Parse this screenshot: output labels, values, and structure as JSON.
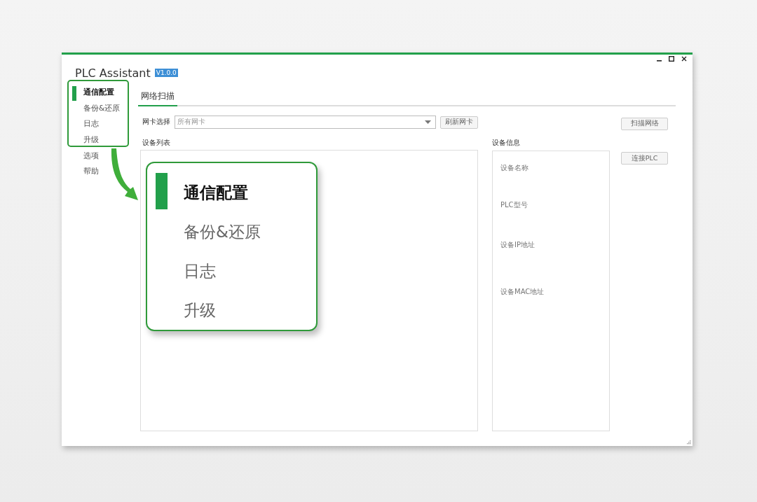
{
  "window": {
    "title": "PLC Assistant",
    "version": "V1.0.0"
  },
  "sidebar": {
    "items": [
      {
        "label": "通信配置",
        "selected": true
      },
      {
        "label": "备份&还原",
        "selected": false
      },
      {
        "label": "日志",
        "selected": false
      },
      {
        "label": "升级",
        "selected": false
      },
      {
        "label": "选项",
        "selected": false
      },
      {
        "label": "帮助",
        "selected": false
      }
    ]
  },
  "tabs": [
    {
      "label": "网络扫描",
      "selected": true
    }
  ],
  "nic": {
    "label": "网卡选择",
    "placeholder": "所有网卡",
    "refresh_button": "刷新网卡"
  },
  "scan_button": "扫描网络",
  "connect_button": "连接PLC",
  "device_list": {
    "title": "设备列表"
  },
  "device_info": {
    "title": "设备信息",
    "fields": [
      "设备名称",
      "PLC型号",
      "设备IP地址",
      "设备MAC地址"
    ]
  },
  "callout": {
    "items": [
      {
        "label": "通信配置",
        "selected": true
      },
      {
        "label": "备份&还原",
        "selected": false
      },
      {
        "label": "日志",
        "selected": false
      },
      {
        "label": "升级",
        "selected": false
      }
    ]
  }
}
